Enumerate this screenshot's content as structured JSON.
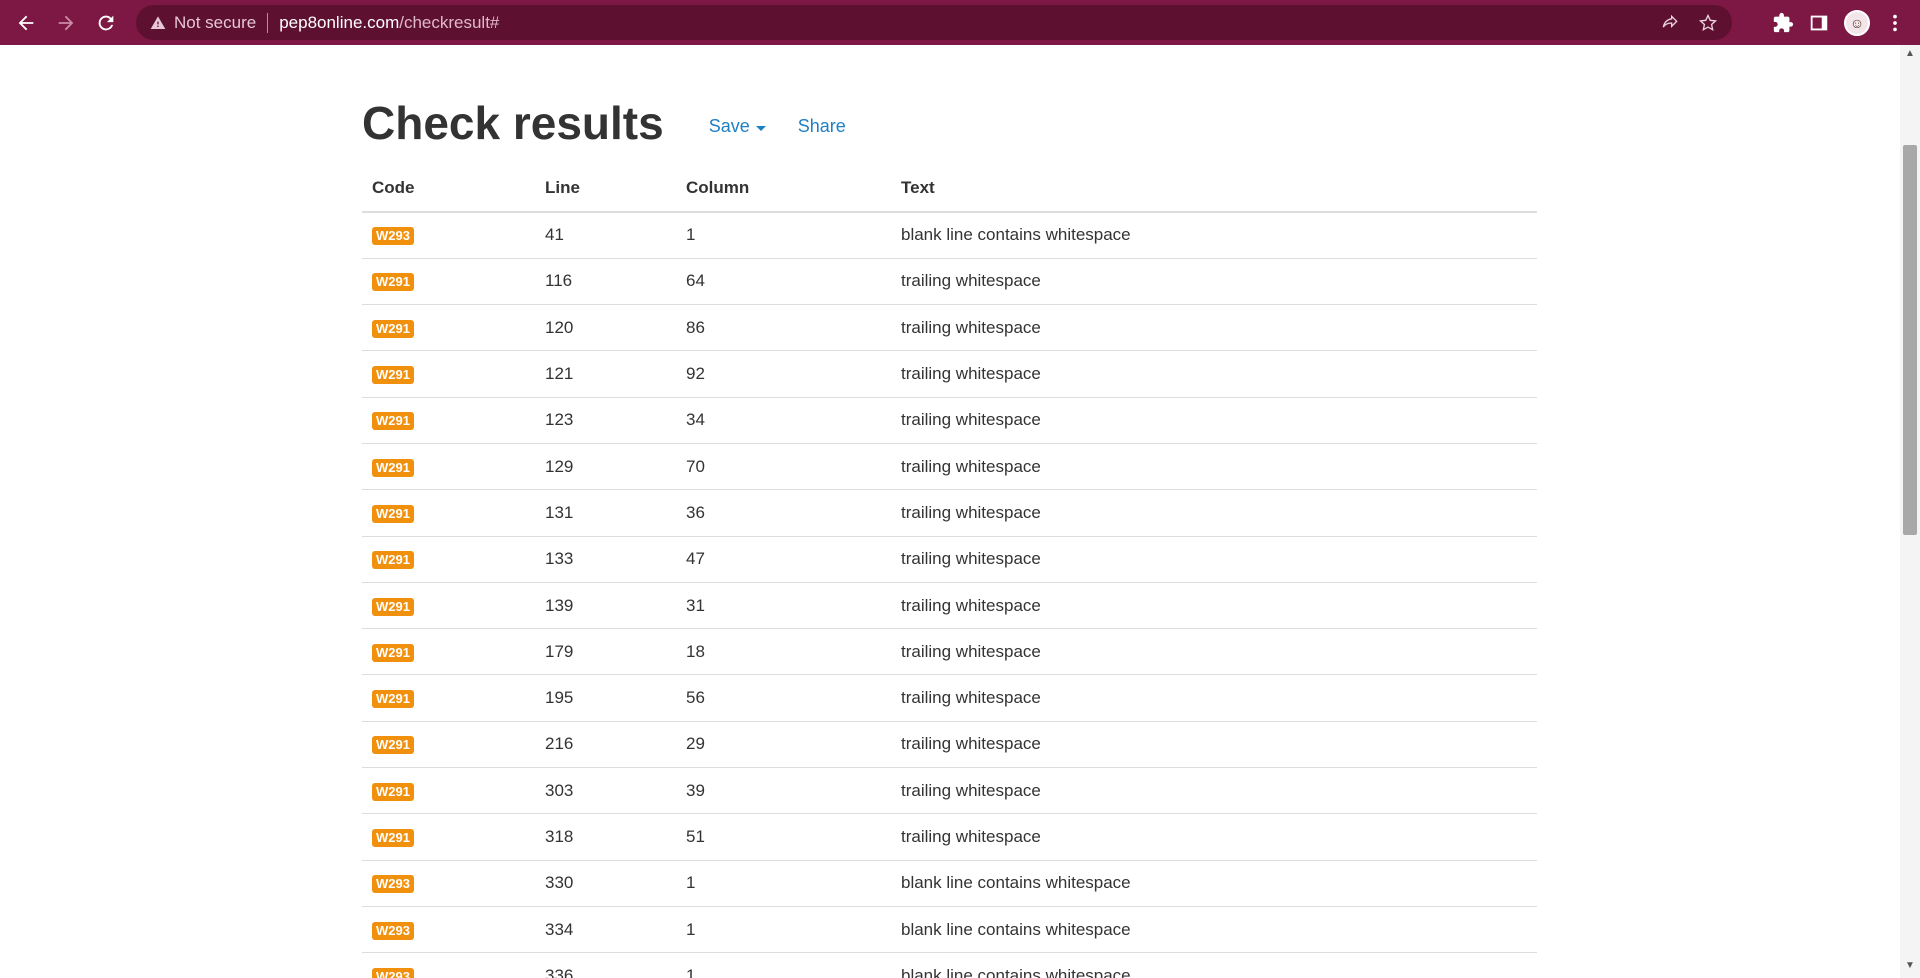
{
  "browser": {
    "security_label": "Not secure",
    "url_host": "pep8online.com",
    "url_path": "/checkresult#",
    "avatar_glyph": "☺",
    "icons": [
      "back-icon",
      "forward-icon",
      "reload-icon",
      "warning-icon",
      "share-icon",
      "star-icon",
      "extensions-icon",
      "side-panel-icon",
      "menu-icon"
    ],
    "theme_color": "#7d1743"
  },
  "page": {
    "title": "Check results",
    "save_label": "Save",
    "share_label": "Share",
    "link_color": "#1f7fc4",
    "badge_color": "#f0900d"
  },
  "table": {
    "headers": {
      "code": "Code",
      "line": "Line",
      "column": "Column",
      "text": "Text"
    },
    "rows": [
      {
        "code": "W293",
        "line": "41",
        "column": "1",
        "text": "blank line contains whitespace"
      },
      {
        "code": "W291",
        "line": "116",
        "column": "64",
        "text": "trailing whitespace"
      },
      {
        "code": "W291",
        "line": "120",
        "column": "86",
        "text": "trailing whitespace"
      },
      {
        "code": "W291",
        "line": "121",
        "column": "92",
        "text": "trailing whitespace"
      },
      {
        "code": "W291",
        "line": "123",
        "column": "34",
        "text": "trailing whitespace"
      },
      {
        "code": "W291",
        "line": "129",
        "column": "70",
        "text": "trailing whitespace"
      },
      {
        "code": "W291",
        "line": "131",
        "column": "36",
        "text": "trailing whitespace"
      },
      {
        "code": "W291",
        "line": "133",
        "column": "47",
        "text": "trailing whitespace"
      },
      {
        "code": "W291",
        "line": "139",
        "column": "31",
        "text": "trailing whitespace"
      },
      {
        "code": "W291",
        "line": "179",
        "column": "18",
        "text": "trailing whitespace"
      },
      {
        "code": "W291",
        "line": "195",
        "column": "56",
        "text": "trailing whitespace"
      },
      {
        "code": "W291",
        "line": "216",
        "column": "29",
        "text": "trailing whitespace"
      },
      {
        "code": "W291",
        "line": "303",
        "column": "39",
        "text": "trailing whitespace"
      },
      {
        "code": "W291",
        "line": "318",
        "column": "51",
        "text": "trailing whitespace"
      },
      {
        "code": "W293",
        "line": "330",
        "column": "1",
        "text": "blank line contains whitespace"
      },
      {
        "code": "W293",
        "line": "334",
        "column": "1",
        "text": "blank line contains whitespace"
      },
      {
        "code": "W293",
        "line": "336",
        "column": "1",
        "text": "blank line contains whitespace"
      }
    ]
  }
}
